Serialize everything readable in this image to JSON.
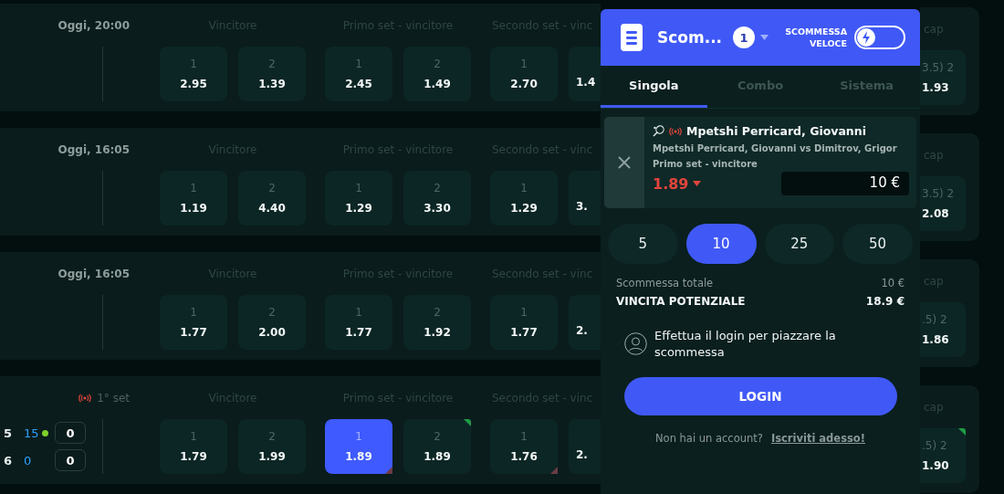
{
  "events": [
    {
      "kind": "scheduled",
      "time": "Oggi, 20:00",
      "markets": [
        {
          "title": "Vincitore",
          "odds": [
            {
              "label": "1",
              "value": "2.95",
              "selected": false,
              "rising": false,
              "falling": false
            },
            {
              "label": "2",
              "value": "1.39",
              "selected": false,
              "rising": false,
              "falling": false
            }
          ]
        },
        {
          "title": "Primo set - vincitore",
          "odds": [
            {
              "label": "1",
              "value": "2.45",
              "selected": false,
              "rising": false,
              "falling": false
            },
            {
              "label": "2",
              "value": "1.49",
              "selected": false,
              "rising": false,
              "falling": false
            }
          ]
        },
        {
          "title": "Secondo set - vinc",
          "odds": [
            {
              "label": "1",
              "value": "2.70",
              "selected": false,
              "rising": false,
              "falling": false
            },
            {
              "value": "1.4",
              "selected": false,
              "rising": false,
              "falling": false
            }
          ]
        }
      ],
      "side": {
        "title": "cap",
        "label": "3.5) 2",
        "value": "1.93",
        "rising": false
      }
    },
    {
      "kind": "scheduled",
      "time": "Oggi, 16:05",
      "markets": [
        {
          "title": "Vincitore",
          "odds": [
            {
              "label": "1",
              "value": "1.19",
              "selected": false,
              "rising": false,
              "falling": false
            },
            {
              "label": "2",
              "value": "4.40",
              "selected": false,
              "rising": false,
              "falling": false
            }
          ]
        },
        {
          "title": "Primo set - vincitore",
          "odds": [
            {
              "label": "1",
              "value": "1.29",
              "selected": false,
              "rising": false,
              "falling": false
            },
            {
              "label": "2",
              "value": "3.30",
              "selected": false,
              "rising": false,
              "falling": false
            }
          ]
        },
        {
          "title": "Secondo set - vinc",
          "odds": [
            {
              "label": "1",
              "value": "1.29",
              "selected": false,
              "rising": false,
              "falling": false
            },
            {
              "value": "3.",
              "selected": false,
              "rising": false,
              "falling": false
            }
          ]
        }
      ],
      "side": {
        "title": "cap",
        "label": "3.5) 2",
        "value": "2.08",
        "rising": false
      }
    },
    {
      "kind": "scheduled",
      "time": "Oggi, 16:05",
      "markets": [
        {
          "title": "Vincitore",
          "odds": [
            {
              "label": "1",
              "value": "1.77",
              "selected": false,
              "rising": false,
              "falling": false
            },
            {
              "label": "2",
              "value": "2.00",
              "selected": false,
              "rising": false,
              "falling": false
            }
          ]
        },
        {
          "title": "Primo set - vincitore",
          "odds": [
            {
              "label": "1",
              "value": "1.77",
              "selected": false,
              "rising": false,
              "falling": false
            },
            {
              "label": "2",
              "value": "1.92",
              "selected": false,
              "rising": false,
              "falling": false
            }
          ]
        },
        {
          "title": "Secondo set - vinc",
          "odds": [
            {
              "label": "1",
              "value": "1.77",
              "selected": false,
              "rising": false,
              "falling": false
            },
            {
              "value": "2.",
              "selected": false,
              "rising": false,
              "falling": false
            }
          ]
        }
      ],
      "side": {
        "title": "cap",
        "label": ".5) 2",
        "value": "1.86",
        "rising": false
      }
    },
    {
      "kind": "live",
      "time": "1° set",
      "scores": [
        {
          "games": "5",
          "points": "15",
          "serving": true,
          "sets": "0"
        },
        {
          "games": "6",
          "points": "0",
          "serving": false,
          "sets": "0"
        }
      ],
      "markets": [
        {
          "title": "Vincitore",
          "odds": [
            {
              "label": "1",
              "value": "1.79",
              "selected": false,
              "rising": false,
              "falling": false
            },
            {
              "label": "2",
              "value": "1.99",
              "selected": false,
              "rising": false,
              "falling": false
            }
          ]
        },
        {
          "title": "Primo set - vincitore",
          "odds": [
            {
              "label": "1",
              "value": "1.89",
              "selected": true,
              "rising": false,
              "falling": true
            },
            {
              "label": "2",
              "value": "1.89",
              "selected": false,
              "rising": true,
              "falling": false
            }
          ]
        },
        {
          "title": "Secondo set - vinc",
          "odds": [
            {
              "label": "1",
              "value": "1.76",
              "selected": false,
              "rising": false,
              "falling": true
            },
            {
              "value": "2.",
              "selected": false,
              "rising": false,
              "falling": false
            }
          ]
        }
      ],
      "side": {
        "title": "cap",
        "label": ".5) 2",
        "value": "1.90",
        "rising": true
      }
    }
  ],
  "betslip": {
    "title": "Scom...",
    "count": "1",
    "quick_bet": {
      "label": "SCOMMESSA VELOCE",
      "on": false
    },
    "tabs": [
      {
        "label": "Singola",
        "selected": true
      },
      {
        "label": "Combo",
        "selected": false
      },
      {
        "label": "Sistema",
        "selected": false
      }
    ],
    "bet": {
      "live": true,
      "selection": "Mpetshi Perricard, Giovanni",
      "match": "Mpetshi Perricard, Giovanni vs Dimitrov, Grigor",
      "market": "Primo set - vincitore",
      "odds": "1.89",
      "falling": true,
      "stake": "10 €"
    },
    "amounts": [
      {
        "label": "5",
        "selected": false
      },
      {
        "label": "10",
        "selected": true
      },
      {
        "label": "25",
        "selected": false
      },
      {
        "label": "50",
        "selected": false
      }
    ],
    "total_label": "Scommessa totale",
    "total": "10 €",
    "win_label": "VINCITA POTENZIALE",
    "win": "18.9 €",
    "login_prompt": "Effettua il login per piazzare la scommessa",
    "login_button": "LOGIN",
    "signup_question": "Non hai un account?",
    "signup_link": "Iscriviti adesso!"
  }
}
